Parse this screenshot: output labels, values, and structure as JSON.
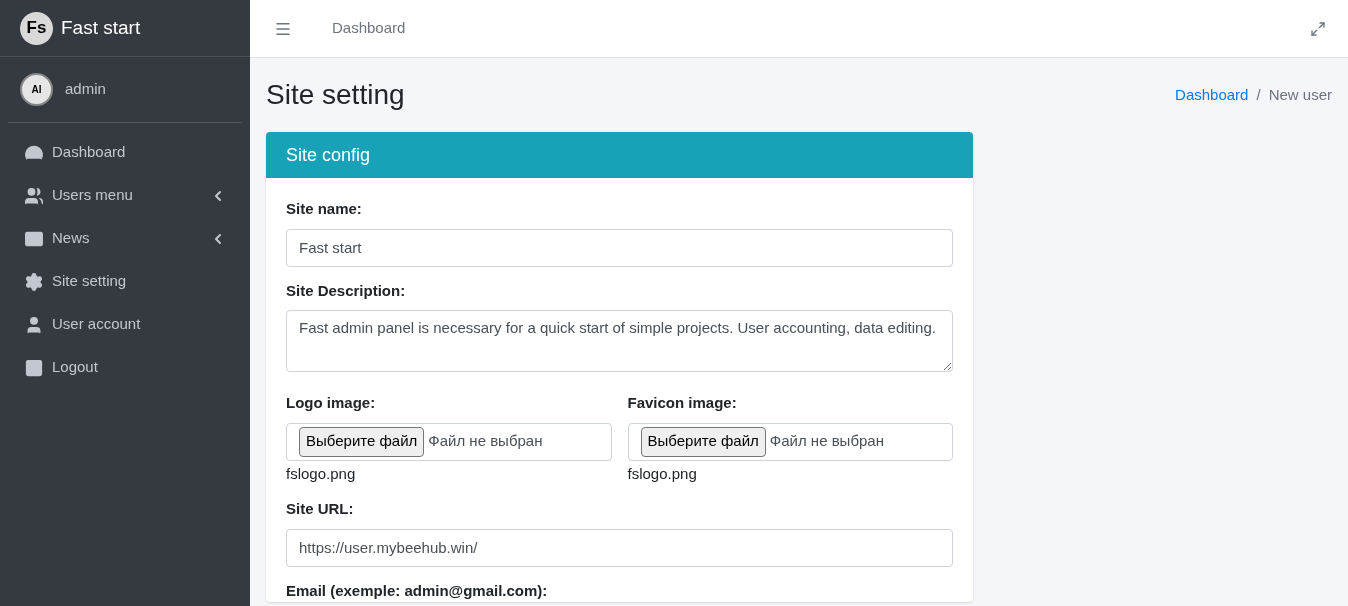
{
  "brand": {
    "logo": "Fs",
    "name": "Fast start"
  },
  "user": {
    "avatar": "AI",
    "name": "admin"
  },
  "sidebar": {
    "items": [
      {
        "label": "Dashboard",
        "has_submenu": false
      },
      {
        "label": "Users menu",
        "has_submenu": true
      },
      {
        "label": "News",
        "has_submenu": true
      },
      {
        "label": "Site setting",
        "has_submenu": false
      },
      {
        "label": "User account",
        "has_submenu": false
      },
      {
        "label": "Logout",
        "has_submenu": false
      }
    ]
  },
  "topbar": {
    "link": "Dashboard"
  },
  "page_title": "Site setting",
  "breadcrumb": {
    "separator": "/",
    "items": [
      {
        "label": "Dashboard",
        "link": true
      },
      {
        "label": "New user",
        "link": false
      }
    ]
  },
  "card": {
    "title": "Site config",
    "fields": [
      {
        "kind": "text",
        "label": "Site name:",
        "value": "Fast start"
      },
      {
        "kind": "textarea",
        "label": "Site Description:",
        "value": "Fast admin panel is necessary for a quick start of simple projects. User accounting, data editing."
      },
      {
        "kind": "files",
        "items": [
          {
            "label": "Logo image:",
            "button": "Выберите файл",
            "status": "Файл не выбран",
            "current": "fslogo.png"
          },
          {
            "label": "Favicon image:",
            "button": "Выберите файл",
            "status": "Файл не выбран",
            "current": "fslogo.png"
          }
        ]
      },
      {
        "kind": "text",
        "label": "Site URL:",
        "value": "https://user.mybeehub.win/"
      },
      {
        "kind": "label",
        "label": "Email (exemple: admin@gmail.com):"
      }
    ]
  }
}
